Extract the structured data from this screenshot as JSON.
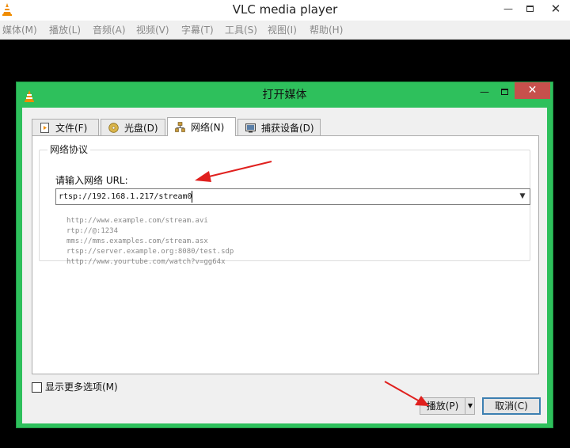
{
  "window": {
    "title": "VLC media player",
    "minimize_glyph": "—",
    "close_glyph": "✕"
  },
  "menubar": {
    "items": [
      {
        "label": "媒体(M)"
      },
      {
        "label": "播放(L)"
      },
      {
        "label": "音频(A)"
      },
      {
        "label": "视频(V)"
      },
      {
        "label": "字幕(T)"
      },
      {
        "label": "工具(S)"
      },
      {
        "label": "视图(I)"
      },
      {
        "label": "帮助(H)"
      }
    ]
  },
  "dialog": {
    "title": "打开媒体",
    "minimize_glyph": "—",
    "close_glyph": "✕",
    "tabs": [
      {
        "label": "文件(F)",
        "icon": "file-play-icon",
        "active": false
      },
      {
        "label": "光盘(D)",
        "icon": "disc-icon",
        "active": false
      },
      {
        "label": "网络(N)",
        "icon": "network-icon",
        "active": true
      },
      {
        "label": "捕获设备(D)",
        "icon": "capture-device-icon",
        "active": false
      }
    ],
    "network": {
      "group_title": "网络协议",
      "url_label": "请输入网络 URL:",
      "url_value": "rtsp://192.168.1.217/stream0",
      "examples": [
        "http://www.example.com/stream.avi",
        "rtp://@:1234",
        "mms://mms.examples.com/stream.asx",
        "rtsp://server.example.org:8080/test.sdp",
        "http://www.yourtube.com/watch?v=gg64x"
      ]
    },
    "show_more_options": {
      "label": "显示更多选项(M)",
      "checked": false
    },
    "buttons": {
      "play": "播放(P)",
      "cancel": "取消(C)"
    }
  },
  "colors": {
    "dialog_frame": "#2ec05c",
    "close_button": "#c7504c",
    "annotation_arrow": "#e0201e",
    "vlc_orange": "#f08c00"
  }
}
